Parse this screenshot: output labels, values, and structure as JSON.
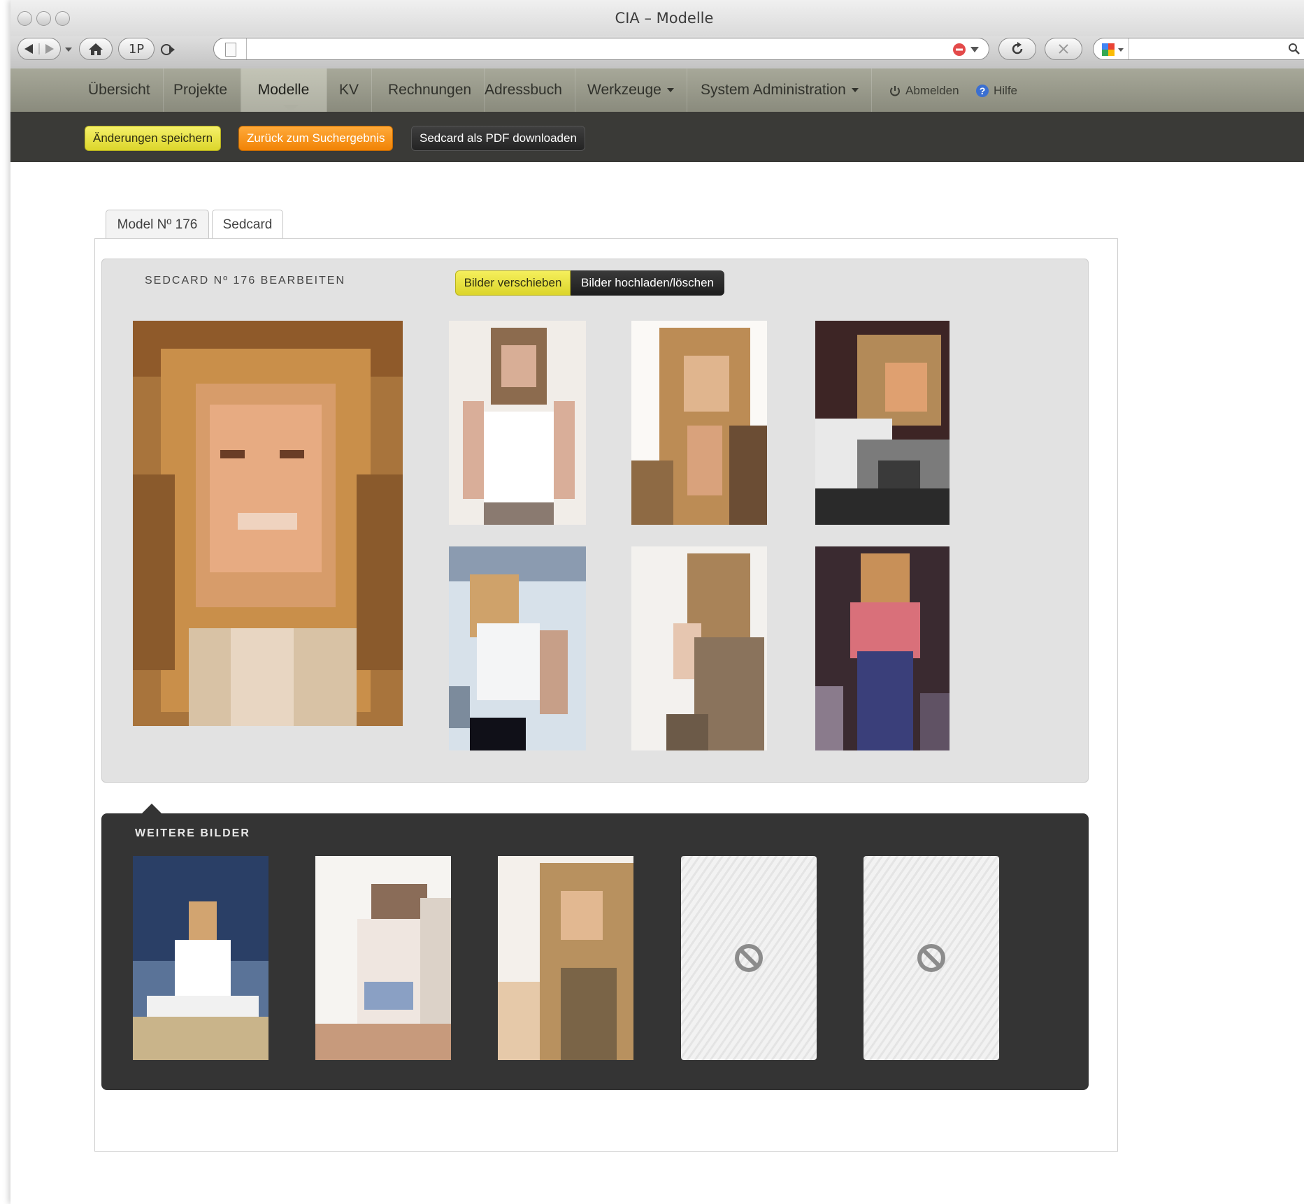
{
  "browser": {
    "window_title": "CIA – Modelle",
    "home_label": "⌂",
    "onepass_label": "1P"
  },
  "nav": {
    "items": [
      {
        "label": "Übersicht"
      },
      {
        "label": "Projekte"
      },
      {
        "label": "Modelle",
        "active": true
      },
      {
        "label": "KV"
      },
      {
        "label": "Rechnungen"
      },
      {
        "label": "Adressbuch"
      },
      {
        "label": "Werkzeuge"
      },
      {
        "label": "System Administration"
      }
    ],
    "logout_label": "Abmelden",
    "help_label": "Hilfe"
  },
  "actions": {
    "save_label": "Änderungen speichern",
    "back_label": "Zurück zum Suchergebnis",
    "pdf_label": "Sedcard als PDF downloaden"
  },
  "tabs": [
    {
      "label": "Model Nº 176"
    },
    {
      "label": "Sedcard",
      "active": true
    }
  ],
  "sedcard": {
    "heading": "SEDCARD Nº 176 BEARBEITEN",
    "mode_move_label": "Bilder verschieben",
    "mode_upload_label": "Bilder hochladen/löschen"
  },
  "more": {
    "heading": "WEITERE BILDER"
  },
  "colors": {
    "nav_bg": "#9a9b8d",
    "action_bar_bg": "#3a3a37",
    "save_yellow": "#e6e040",
    "back_orange": "#f7900f",
    "panel_bg": "#e2e2e2",
    "more_panel_bg": "#343434"
  }
}
